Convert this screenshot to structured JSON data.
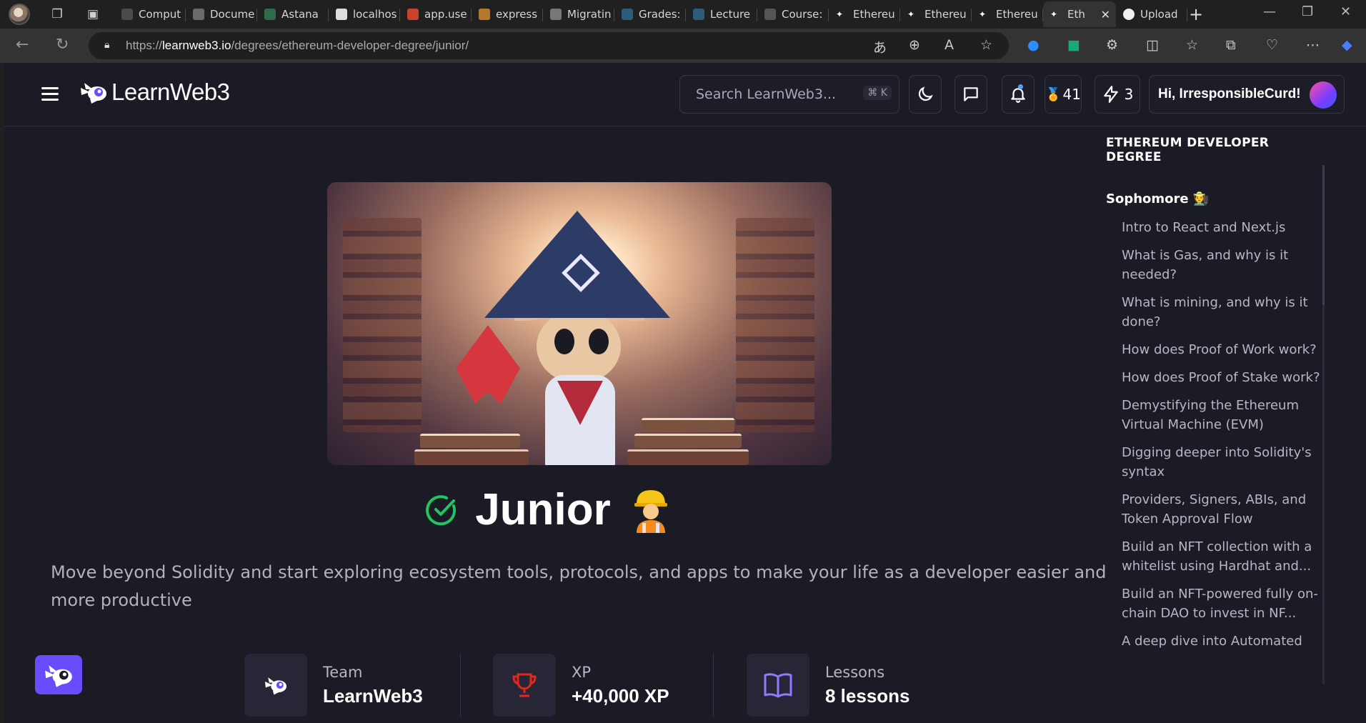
{
  "browser": {
    "tabs": [
      {
        "label": "Comput",
        "fav": "#4a4a4a"
      },
      {
        "label": "Docume",
        "fav": "#6a6a6a"
      },
      {
        "label": "Astana",
        "fav": "#2f6b4a"
      },
      {
        "label": "localhos",
        "fav": "#dddddd"
      },
      {
        "label": "app.use",
        "fav": "#c8432b"
      },
      {
        "label": "express",
        "fav": "#b4792d"
      },
      {
        "label": "Migratin",
        "fav": "#777777"
      },
      {
        "label": "Grades:",
        "fav": "#2d5b7a"
      },
      {
        "label": "Lecture",
        "fav": "#2d5b7a"
      },
      {
        "label": "Course:",
        "fav": "#555555"
      },
      {
        "label": "Ethereu",
        "fav": "lw"
      },
      {
        "label": "Ethereu",
        "fav": "lw"
      },
      {
        "label": "Ethereu",
        "fav": "lw"
      },
      {
        "label": "Eth",
        "fav": "lw",
        "active": true
      },
      {
        "label": "Upload",
        "fav": "github"
      }
    ],
    "url": {
      "prefix": "https://",
      "host": "learnweb3.io",
      "path": "/degrees/ethereum-developer-degree/junior/"
    }
  },
  "header": {
    "logo_text": "LearnWeb3",
    "search_placeholder": "Search LearnWeb3...",
    "search_shortcut": "⌘ K",
    "badges_count": "41",
    "streak_count": "3",
    "greeting": "Hi, IrresponsibleCurd!"
  },
  "main": {
    "title": "Junior",
    "description": "Move beyond Solidity and start exploring ecosystem tools, protocols, and apps to make your life as a developer easier and more productive",
    "stats": [
      {
        "label": "Team",
        "value": "LearnWeb3"
      },
      {
        "label": "XP",
        "value": "+40,000 XP"
      },
      {
        "label": "Lessons",
        "value": "8 lessons"
      }
    ]
  },
  "toc": {
    "heading": "ETHEREUM DEVELOPER DEGREE",
    "section": "Sophomore 🧑‍🌾",
    "items": [
      "Intro to React and Next.js",
      "What is Gas, and why is it needed?",
      "What is mining, and why is it done?",
      "How does Proof of Work work?",
      "How does Proof of Stake work?",
      "Demystifying the Ethereum Virtual Machine (EVM)",
      "Digging deeper into Solidity's syntax",
      "Providers, Signers, ABIs, and Token Approval Flow",
      "Build an NFT collection with a whitelist using Hardhat and...",
      "Build an NFT-powered fully on-chain DAO to invest in NF...",
      "A deep dive into Automated"
    ]
  },
  "colors": {
    "accent": "#6a4cff",
    "check": "#22c55e",
    "xp_trophy": "#e0281e",
    "lessons_book": "#8f7bff"
  }
}
